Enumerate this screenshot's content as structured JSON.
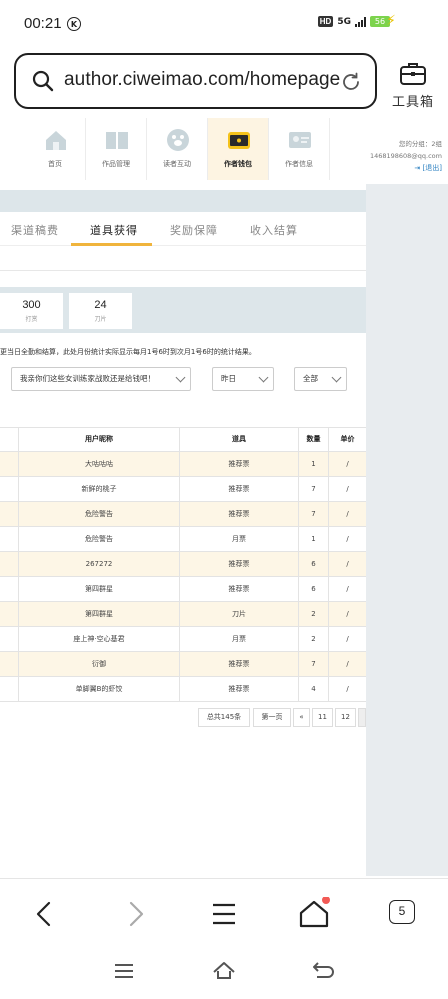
{
  "status": {
    "time": "00:21",
    "carrier_mark": "K",
    "hd": "HD",
    "network": "5G",
    "battery": "56"
  },
  "browser": {
    "url": "author.ciweimao.com/homepage",
    "toolbox_label": "工具箱",
    "tab_count": "5"
  },
  "site_nav": {
    "items": [
      {
        "label": "首页",
        "icon": "house-icon"
      },
      {
        "label": "作品管理",
        "icon": "book-icon"
      },
      {
        "label": "读者互动",
        "icon": "paw-icon"
      },
      {
        "label": "作者钱包",
        "icon": "wallet-icon"
      },
      {
        "label": "作者信息",
        "icon": "id-card-icon"
      }
    ],
    "active_index": 3,
    "user_group": "您的分组：2组",
    "user_email": "1468198608@qq.com",
    "logout": "[退出]"
  },
  "tabs": [
    "渠道稿费",
    "道具获得",
    "奖励保障",
    "收入结算"
  ],
  "active_tab": "道具获得",
  "stats": [
    {
      "value": "300",
      "label": "打赏"
    },
    {
      "value": "24",
      "label": "刀片"
    }
  ],
  "note": "更当日全勤和结算，此处月份统计实际显示每月1号6时到次月1号6时的统计结果。",
  "filters": {
    "book": "我亲你们这些女训练家战败还是给钱吧！",
    "date": "昨日",
    "type": "全部"
  },
  "table": {
    "headers": [
      "",
      "用户昵称",
      "道具",
      "数量",
      "单价"
    ],
    "rows": [
      {
        "user": "大咕咕咕",
        "item": "推荐票",
        "qty": "1",
        "price": "/"
      },
      {
        "user": "新鲜的桃子",
        "item": "推荐票",
        "qty": "7",
        "price": "/"
      },
      {
        "user": "危险警告",
        "item": "推荐票",
        "qty": "7",
        "price": "/"
      },
      {
        "user": "危险警告",
        "item": "月票",
        "qty": "1",
        "price": "/"
      },
      {
        "user": "267272",
        "item": "推荐票",
        "qty": "6",
        "price": "/"
      },
      {
        "user": "第四群星",
        "item": "推荐票",
        "qty": "6",
        "price": "/"
      },
      {
        "user": "第四群星",
        "item": "刀片",
        "qty": "2",
        "price": "/"
      },
      {
        "user": "座上神·空心基君",
        "item": "月票",
        "qty": "2",
        "price": "/"
      },
      {
        "user": "衍御",
        "item": "推荐票",
        "qty": "7",
        "price": "/"
      },
      {
        "user": "单脚翼B的虾饺",
        "item": "推荐票",
        "qty": "4",
        "price": "/"
      }
    ]
  },
  "pagination": {
    "total": "总共145条",
    "first": "第一页",
    "prev": "«",
    "pages": [
      "11",
      "12"
    ]
  }
}
